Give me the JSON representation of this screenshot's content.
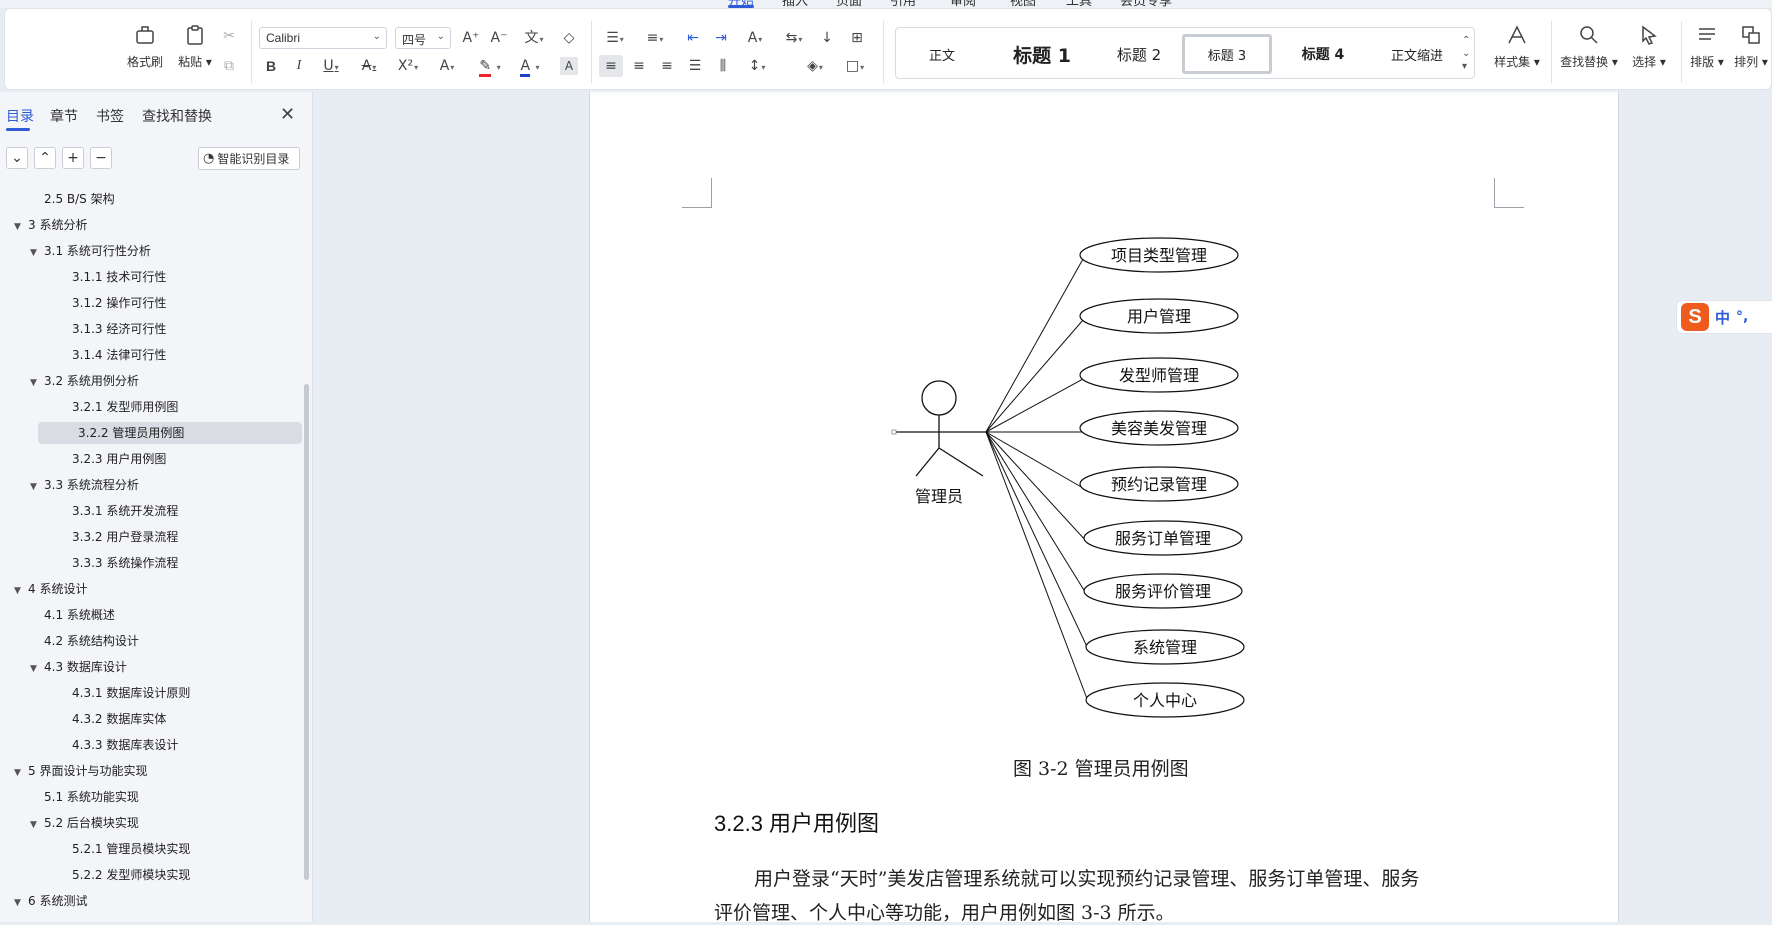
{
  "menu": {
    "tabs": [
      "开始",
      "插入",
      "页面",
      "引用",
      "审阅",
      "视图",
      "工具",
      "会员专享"
    ]
  },
  "ribbon": {
    "format_painter": "格式刷",
    "paste": "粘贴",
    "font_name": "Calibri",
    "font_size": "四号",
    "styles": [
      "正文",
      "标题 1",
      "标题 2",
      "标题 3",
      "标题 4",
      "正文缩进"
    ],
    "style_set": "样式集",
    "find_replace": "查找替换",
    "select": "选择",
    "layout": "排版",
    "arrange": "排列",
    "colors": {
      "highlight": "#e8262b",
      "font": "#1f3fd0",
      "accent": "#2f5bd7"
    }
  },
  "nav": {
    "tabs": [
      "目录",
      "章节",
      "书签",
      "查找和替换"
    ],
    "smart_toc": "智能识别目录",
    "toc": [
      {
        "text": "2.5 B/S 架构",
        "level": 2,
        "expanded": null
      },
      {
        "text": "3 系统分析",
        "level": 1,
        "expanded": true
      },
      {
        "text": "3.1  系统可行性分析",
        "level": 2,
        "expanded": true
      },
      {
        "text": "3.1.1  技术可行性",
        "level": 3,
        "expanded": null
      },
      {
        "text": "3.1.2  操作可行性",
        "level": 3,
        "expanded": null
      },
      {
        "text": "3.1.3  经济可行性",
        "level": 3,
        "expanded": null
      },
      {
        "text": "3.1.4  法律可行性",
        "level": 3,
        "expanded": null
      },
      {
        "text": "3.2 系统用例分析",
        "level": 2,
        "expanded": true
      },
      {
        "text": "3.2.1 发型师用例图",
        "level": 3,
        "expanded": null
      },
      {
        "text": "3.2.2 管理员用例图",
        "level": 3,
        "expanded": null,
        "selected": true
      },
      {
        "text": "3.2.3 用户用例图",
        "level": 3,
        "expanded": null
      },
      {
        "text": "3.3 系统流程分析",
        "level": 2,
        "expanded": true
      },
      {
        "text": "3.3.1  系统开发流程",
        "level": 3,
        "expanded": null
      },
      {
        "text": "3.3.2  用户登录流程",
        "level": 3,
        "expanded": null
      },
      {
        "text": "3.3.3  系统操作流程",
        "level": 3,
        "expanded": null
      },
      {
        "text": "4  系统设计",
        "level": 1,
        "expanded": true
      },
      {
        "text": "4.1  系统概述",
        "level": 2,
        "expanded": null
      },
      {
        "text": "4.2  系统结构设计",
        "level": 2,
        "expanded": null
      },
      {
        "text": "4.3  数据库设计",
        "level": 2,
        "expanded": true
      },
      {
        "text": "4.3.1  数据库设计原则",
        "level": 3,
        "expanded": null
      },
      {
        "text": "4.3.2  数据库实体",
        "level": 3,
        "expanded": null
      },
      {
        "text": "4.3.3  数据库表设计",
        "level": 3,
        "expanded": null
      },
      {
        "text": "5 界面设计与功能实现",
        "level": 1,
        "expanded": true
      },
      {
        "text": "5.1 系统功能实现",
        "level": 2,
        "expanded": null
      },
      {
        "text": "5.2 后台模块实现",
        "level": 2,
        "expanded": true
      },
      {
        "text": "5.2.1 管理员模块实现",
        "level": 3,
        "expanded": null
      },
      {
        "text": "5.2.2 发型师模块实现",
        "level": 3,
        "expanded": null
      },
      {
        "text": "6 系统测试",
        "level": 1,
        "expanded": true
      }
    ]
  },
  "document": {
    "diagram": {
      "actor": "管理员",
      "use_cases": [
        "项目类型管理",
        "用户管理",
        "发型师管理",
        "美容美发管理",
        "预约记录管理",
        "服务订单管理",
        "服务评价管理",
        "系统管理",
        "个人中心"
      ]
    },
    "caption": "图 3-2 管理员用例图",
    "heading": "3.2.3 用户用例图",
    "para_line1": "用户登录“天时”美发店管理系统就可以实现预约记录管理、服务订单管理、服务",
    "para_line2": "评价管理、个人中心等功能，用户用例如图 3-3 所示。"
  },
  "ime": {
    "mode": "中",
    "punct": "°,"
  }
}
